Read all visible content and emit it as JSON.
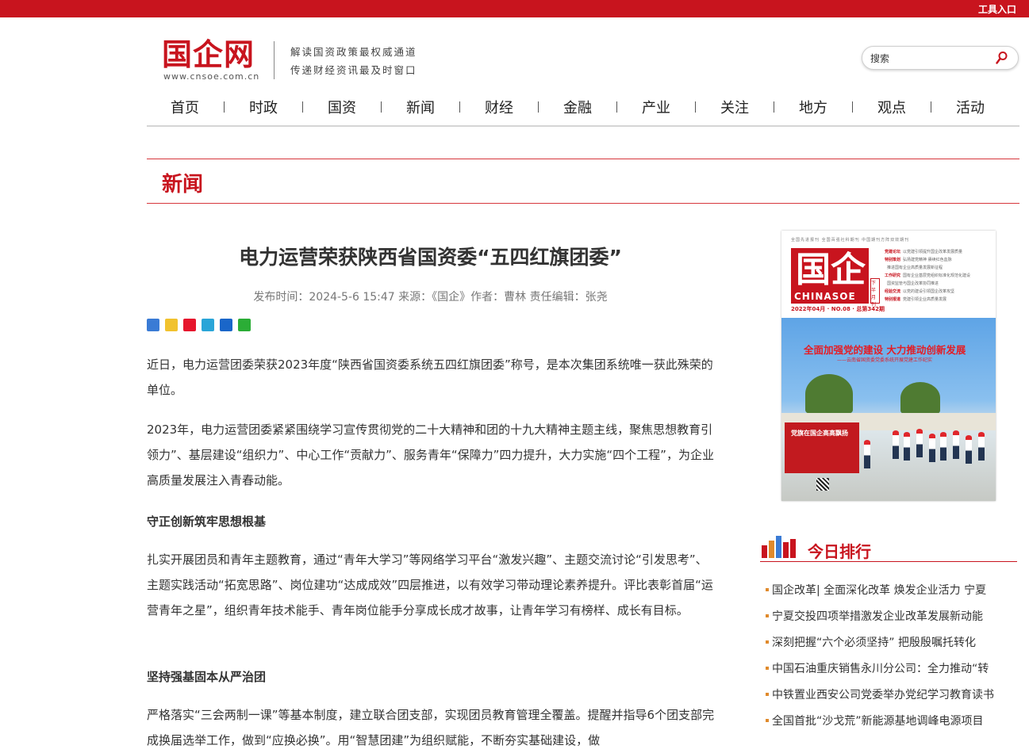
{
  "topbar": {
    "tool_entry": "工具入口"
  },
  "header": {
    "logo_text": "国企网",
    "logo_url": "www.cnsoe.com.cn",
    "slogan_line1": "解读国资政策最权威通道",
    "slogan_line2": "传递财经资讯最及时窗口"
  },
  "search": {
    "placeholder": "搜索",
    "icon": "search-icon"
  },
  "nav": {
    "items": [
      "首页",
      "时政",
      "国资",
      "新闻",
      "财经",
      "金融",
      "产业",
      "关注",
      "地方",
      "观点",
      "活动"
    ]
  },
  "section": {
    "title": "新闻"
  },
  "article": {
    "title": "电力运营荣获陕西省国资委“五四红旗团委”",
    "meta": "发布时间：2024-5-6 15:47 来源：《国企》作者：曹林 责任编辑：张尧",
    "share_icons": [
      "share-more-icon",
      "qzone-icon",
      "weibo-icon",
      "tencent-weibo-icon",
      "renren-icon",
      "wechat-icon"
    ],
    "p1": "近日，电力运营团委荣获2023年度“陕西省国资委系统五四红旗团委”称号，是本次集团系统唯一获此殊荣的单位。",
    "p2": "2023年，电力运营团委紧紧围绕学习宣传贯彻党的二十大精神和团的十九大精神主题主线，聚焦思想教育引领力”、基层建设“组织力”、中心工作“贡献力”、服务青年“保障力”四力提升，大力实施“四个工程”，为企业高质量发展注入青春动能。",
    "h1": "守正创新筑牢思想根基",
    "p3": "扎实开展团员和青年主题教育，通过“青年大学习”等网络学习平台“激发兴趣”、主题交流讨论“引发思考”、主题实践活动“拓宽思路”、岗位建功“达成成效”四层推进，以有效学习带动理论素养提升。评比表彰首届“运营青年之星”，组织青年技术能手、青年岗位能手分享成长成才故事，让青年学习有榜样、成长有目标。",
    "h2": "坚持强基固本从严治团",
    "p4": "严格落实“三会两制一课”等基本制度，建立联合团支部，实现团员教育管理全覆盖。提醒并指导6个团支部完成换届选举工作，做到“应换必换”。用“智慧团建”为组织赋能，不断夯实基础建设，做"
  },
  "cover": {
    "topline": "全国先进报刊 全国百强社科期刊 中国期刊方阵双效期刊",
    "logo": "国企",
    "logo_en": "CHINASOE",
    "issue": "2022年04月 · NO.08 · 总第342期",
    "half_month_tag": "下半月刊",
    "toc": [
      {
        "tag": "党建论坛",
        "text": "以党建引领提升国企改革发展质量"
      },
      {
        "tag": "特别策划",
        "text": "弘扬建党精神 赓续红色血脉"
      },
      {
        "tag": "",
        "text": "推进国有企业高质量发展新征程"
      },
      {
        "tag": "工作研究",
        "text": "国有企业基层党组织标准化规范化建设"
      },
      {
        "tag": "",
        "text": "国资监管与国企改革协同推进"
      },
      {
        "tag": "经验交流",
        "text": "以党的建设引领国企改革攻坚"
      },
      {
        "tag": "特别报道",
        "text": "党建引领企业高质量发展"
      }
    ],
    "headline": "全面加强党的建设 大力推动创新发展",
    "subline": "——云南省国资委党委系统开展党建工作纪实",
    "board_text": "党旗在国企高高飘扬"
  },
  "ranking": {
    "title": "今日排行",
    "items": [
      "国企改革| 全面深化改革 焕发企业活力 宁夏",
      "宁夏交投四项举措激发企业改革发展新动能",
      "深刻把握“六个必须坚持” 把殷殷嘱托转化",
      "中国石油重庆销售永川分公司：全力推动“转",
      "中铁置业西安公司党委举办党纪学习教育读书",
      "全国首批“沙戈荒”新能源基地调峰电源项目"
    ]
  },
  "colors": {
    "brand_red": "#c8141e",
    "bullet_orange": "#e08a2c"
  }
}
